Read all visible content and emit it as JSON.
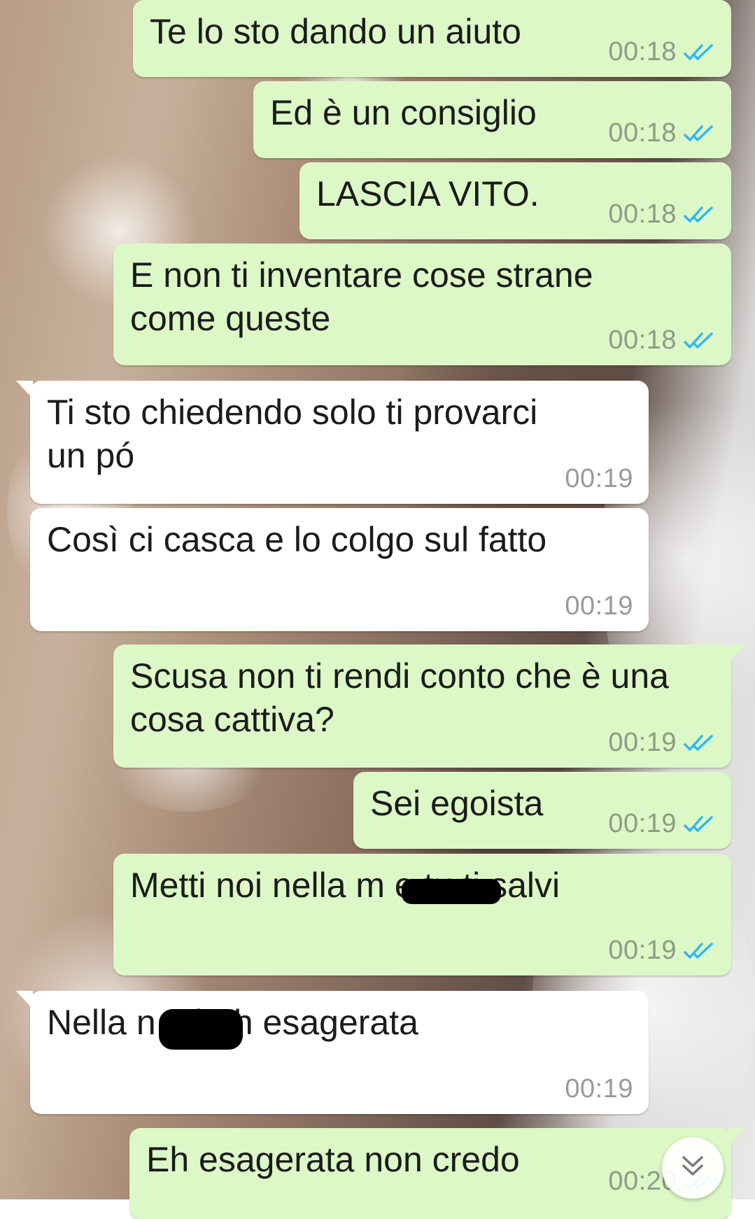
{
  "messages": [
    {
      "direction": "outgoing",
      "text": "Te lo sto dando un aiuto",
      "time": "00:18",
      "status": "read"
    },
    {
      "direction": "outgoing",
      "text": "Ed è un consiglio",
      "time": "00:18",
      "status": "read"
    },
    {
      "direction": "outgoing",
      "text": "LASCIA VITO.",
      "time": "00:18",
      "status": "read"
    },
    {
      "direction": "outgoing",
      "text": "E non ti inventare cose strane\ncome queste",
      "time": "00:18",
      "status": "read"
    },
    {
      "direction": "incoming",
      "text": "Ti sto chiedendo solo ti provarci\nun pó",
      "time": "00:19"
    },
    {
      "direction": "incoming",
      "text": "Così ci casca e lo colgo sul fatto",
      "time": "00:19"
    },
    {
      "direction": "outgoing",
      "text": "Scusa non ti rendi conto che è una\ncosa cattiva?",
      "time": "00:19",
      "status": "read"
    },
    {
      "direction": "outgoing",
      "text": "Sei egoista",
      "time": "00:19",
      "status": "read"
    },
    {
      "direction": "outgoing",
      "text": "Metti noi nella m          e tu ti salvi",
      "time": "00:19",
      "status": "read"
    },
    {
      "direction": "incoming",
      "text": "Nella n          a bah esagerata",
      "time": "00:19"
    },
    {
      "direction": "outgoing",
      "text": "Eh esagerata non credo",
      "time": "00:20",
      "status": "read"
    }
  ],
  "colors": {
    "outgoing_bubble": "#dcf8c6",
    "incoming_bubble": "#ffffff",
    "read_ticks": "#34b7f1",
    "timestamp": "#8c9b86"
  },
  "scroll_button": {
    "icon": "double-chevron-down-icon"
  }
}
